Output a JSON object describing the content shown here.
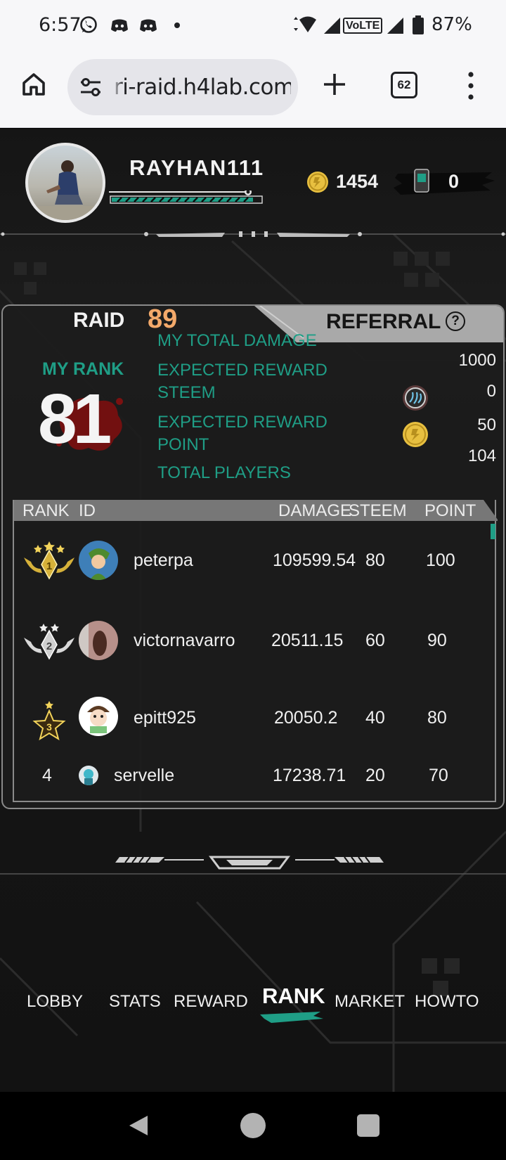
{
  "status_bar": {
    "time": "6:57",
    "battery": "87%",
    "network_badge": "VoLTE"
  },
  "browser": {
    "url": "ri-raid.h4lab.com",
    "tab_count": "62"
  },
  "profile": {
    "username": "RAYHAN111",
    "coins": "1454",
    "device_count": "0",
    "xp_progress": 0.95
  },
  "panel": {
    "raid_label": "RAID",
    "raid_number": "89",
    "referral_label": "REFERRAL",
    "help_symbol": "?",
    "my_rank_label": "MY RANK",
    "my_rank_value": "81",
    "stats": {
      "total_damage_label": "MY TOTAL DAMAGE",
      "total_damage_value": "1000",
      "reward_steem_label": "EXPECTED REWARD STEEM",
      "reward_steem_value": "0",
      "reward_point_label": "EXPECTED REWARD POINT",
      "reward_point_value": "50",
      "total_players_label": "TOTAL PLAYERS",
      "total_players_value": "104"
    }
  },
  "leaderboard": {
    "headers": {
      "rank": "RANK",
      "id": "ID",
      "damage": "DAMAGE",
      "steem": "STEEM",
      "point": "POINT"
    },
    "rows": [
      {
        "rank": "1",
        "id": "peterpa",
        "damage": "109599.54",
        "steem": "80",
        "point": "100"
      },
      {
        "rank": "2",
        "id": "victornavarro",
        "damage": "20511.15",
        "steem": "60",
        "point": "90"
      },
      {
        "rank": "3",
        "id": "epitt925",
        "damage": "20050.2",
        "steem": "40",
        "point": "80"
      },
      {
        "rank": "4",
        "id": "servelle",
        "damage": "17238.71",
        "steem": "20",
        "point": "70"
      }
    ]
  },
  "nav": {
    "lobby": "LOBBY",
    "stats": "STATS",
    "reward": "REWARD",
    "rank": "RANK",
    "market": "MARKET",
    "howto": "HOWTO",
    "active": "RANK"
  },
  "colors": {
    "accent_teal": "#1f9e86",
    "raid_number": "#f3a96a",
    "gold": "#e8c040"
  }
}
